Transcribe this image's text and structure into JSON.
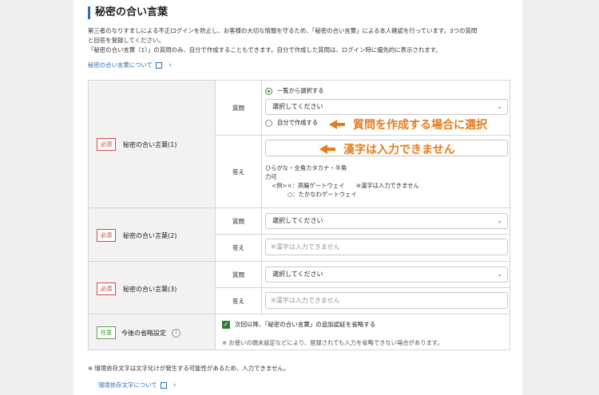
{
  "title": "秘密の合い言葉",
  "intro": {
    "line1": "第三者のなりすましによる不正ログインを防止し、お客様の大切な情報を守るため、「秘密の合い言葉」による本人確認を行っています。3つの質問",
    "line2": "と回答を登録してください。",
    "line3": "「秘密の合い言葉（1）」の質問のみ、自分で作成することもできます。自分で作成した質問は、ログイン時に優先的に表示されます。"
  },
  "about_link": "秘密の合い言葉について",
  "rows": {
    "r1": {
      "badge": "必須",
      "label": "秘密の合い言葉(1)",
      "question_label": "質問",
      "answer_label": "答え",
      "radio_list": "一覧から選択する",
      "select_value": "選択してください",
      "radio_custom": "自分で作成する",
      "note1": "ひらがな・全角カタカナ・半角",
      "note2": "力可",
      "note3": "<例>×：高輪ゲートウェイ　　※漢字は入力できません",
      "note4": "○：たかなわゲートウェイ"
    },
    "r2": {
      "badge": "必須",
      "label": "秘密の合い言葉(2)",
      "question_label": "質問",
      "answer_label": "答え",
      "select_value": "選択してください",
      "placeholder": "※漢字は入力できません"
    },
    "r3": {
      "badge": "必須",
      "label": "秘密の合い言葉(3)",
      "question_label": "質問",
      "answer_label": "答え",
      "select_value": "選択してください",
      "placeholder": "※漢字は入力できません"
    },
    "r4": {
      "badge": "任意",
      "label": "今後の省略設定",
      "help": "?",
      "checkbox_label": "次回以降、「秘密の合い言葉」の追加認証を省略する",
      "note": "※ お使いの端末設定などにより、登録されても入力を省略できない場合があります。"
    }
  },
  "callouts": {
    "c1": "質問を作成する場合に選択",
    "c2": "漢字は入力できません"
  },
  "footer_note": "※ 環境依存文字は文字化けが発生する可能性があるため、入力できません。",
  "env_link": "環境依存文字について",
  "colors": {
    "accent": "#2a6fb5",
    "required": "#c0392b",
    "optional": "#3a8a2a",
    "callout": "#e97b18"
  }
}
